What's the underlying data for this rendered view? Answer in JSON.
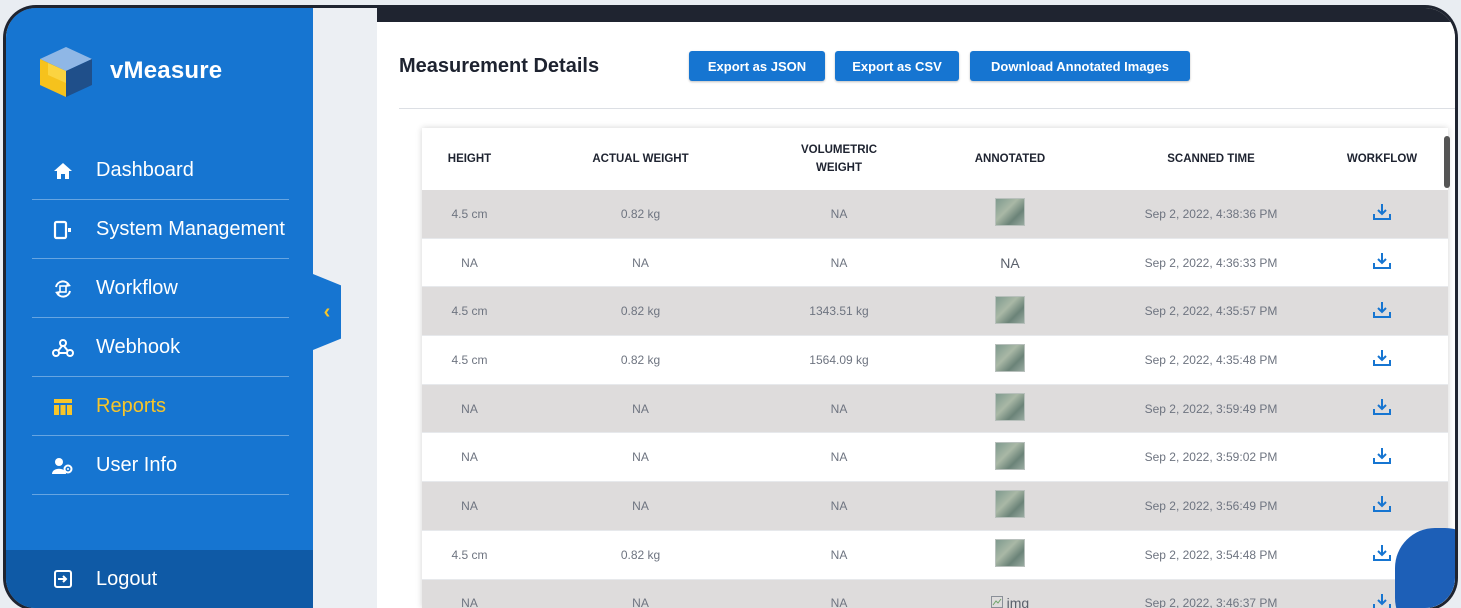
{
  "app": {
    "name": "vMeasure"
  },
  "sidebar": {
    "items": [
      {
        "label": "Dashboard",
        "icon": "home-icon"
      },
      {
        "label": "System Management",
        "icon": "device-icon"
      },
      {
        "label": "Workflow",
        "icon": "workflow-icon"
      },
      {
        "label": "Webhook",
        "icon": "webhook-icon"
      },
      {
        "label": "Reports",
        "icon": "table-icon",
        "active": true
      },
      {
        "label": "User Info",
        "icon": "users-icon"
      }
    ],
    "logout_label": "Logout",
    "collapse_icon": "chevron-left-icon"
  },
  "main": {
    "title": "Measurement Details",
    "buttons": {
      "export_json": "Export as JSON",
      "export_csv": "Export as CSV",
      "download_images": "Download Annotated Images"
    },
    "table": {
      "columns": [
        "HEIGHT",
        "ACTUAL WEIGHT",
        "VOLUMETRIC WEIGHT",
        "ANNOTATED",
        "SCANNED TIME",
        "WORKFLOW"
      ],
      "rows": [
        {
          "height": "4.5 cm",
          "actual_weight": "0.82 kg",
          "volumetric_weight": "NA",
          "annotated": "image",
          "scanned_time": "Sep 2, 2022, 4:38:36 PM"
        },
        {
          "height": "NA",
          "actual_weight": "NA",
          "volumetric_weight": "NA",
          "annotated": "NA",
          "scanned_time": "Sep 2, 2022, 4:36:33 PM"
        },
        {
          "height": "4.5 cm",
          "actual_weight": "0.82 kg",
          "volumetric_weight": "1343.51 kg",
          "annotated": "image",
          "scanned_time": "Sep 2, 2022, 4:35:57 PM"
        },
        {
          "height": "4.5 cm",
          "actual_weight": "0.82 kg",
          "volumetric_weight": "1564.09 kg",
          "annotated": "image",
          "scanned_time": "Sep 2, 2022, 4:35:48 PM"
        },
        {
          "height": "NA",
          "actual_weight": "NA",
          "volumetric_weight": "NA",
          "annotated": "image",
          "scanned_time": "Sep 2, 2022, 3:59:49 PM"
        },
        {
          "height": "NA",
          "actual_weight": "NA",
          "volumetric_weight": "NA",
          "annotated": "image",
          "scanned_time": "Sep 2, 2022, 3:59:02 PM"
        },
        {
          "height": "NA",
          "actual_weight": "NA",
          "volumetric_weight": "NA",
          "annotated": "image",
          "scanned_time": "Sep 2, 2022, 3:56:49 PM"
        },
        {
          "height": "4.5 cm",
          "actual_weight": "0.82 kg",
          "volumetric_weight": "NA",
          "annotated": "image",
          "scanned_time": "Sep 2, 2022, 3:54:48 PM"
        },
        {
          "height": "NA",
          "actual_weight": "NA",
          "volumetric_weight": "NA",
          "annotated": "img",
          "scanned_time": "Sep 2, 2022, 3:46:37 PM"
        }
      ],
      "workflow_icon": "download-icon"
    }
  },
  "colors": {
    "sidebar": "#1675d1",
    "active": "#f7c52a",
    "button": "#1675d1",
    "row_alt": "#dedcdc"
  }
}
